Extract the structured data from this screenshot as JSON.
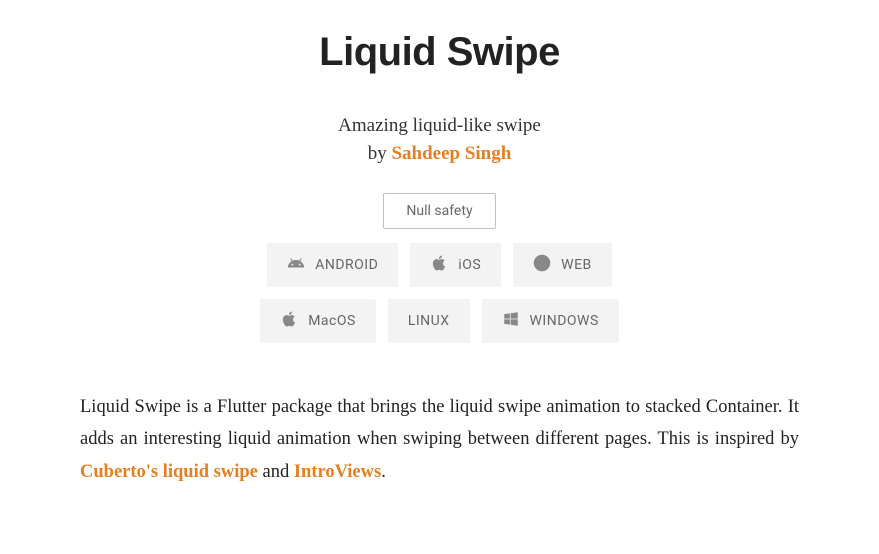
{
  "title": "Liquid Swipe",
  "subtitle": "Amazing liquid-like swipe",
  "byline_prefix": "by ",
  "author": "Sahdeep Singh",
  "null_safety_label": "Null safety",
  "platforms_row1": [
    {
      "label": "ANDROID",
      "icon": "android"
    },
    {
      "label": "iOS",
      "icon": "apple"
    },
    {
      "label": "WEB",
      "icon": "globe"
    }
  ],
  "platforms_row2": [
    {
      "label": "MacOS",
      "icon": "apple"
    },
    {
      "label": "LINUX",
      "icon": ""
    },
    {
      "label": "WINDOWS",
      "icon": "windows"
    }
  ],
  "description": {
    "text_before": "Liquid Swipe is a Flutter package that brings the liquid swipe animation to stacked Container. It adds an interesting liquid animation when swiping between different pages. This is inspired by ",
    "link1": "Cuberto's liquid swipe",
    "text_middle": " and ",
    "link2": "IntroViews",
    "text_after": "."
  }
}
